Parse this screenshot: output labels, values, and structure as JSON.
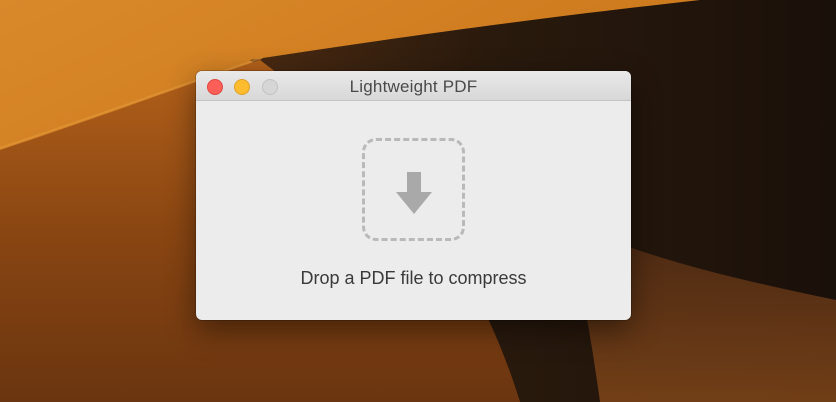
{
  "window": {
    "title": "Lightweight PDF"
  },
  "drop_zone": {
    "icon": "arrow-down-icon",
    "label": "Drop a PDF file to compress"
  },
  "colors": {
    "close": "#fc5f57",
    "minimize": "#fdbc2e",
    "zoom_disabled": "#d6d6d6"
  }
}
